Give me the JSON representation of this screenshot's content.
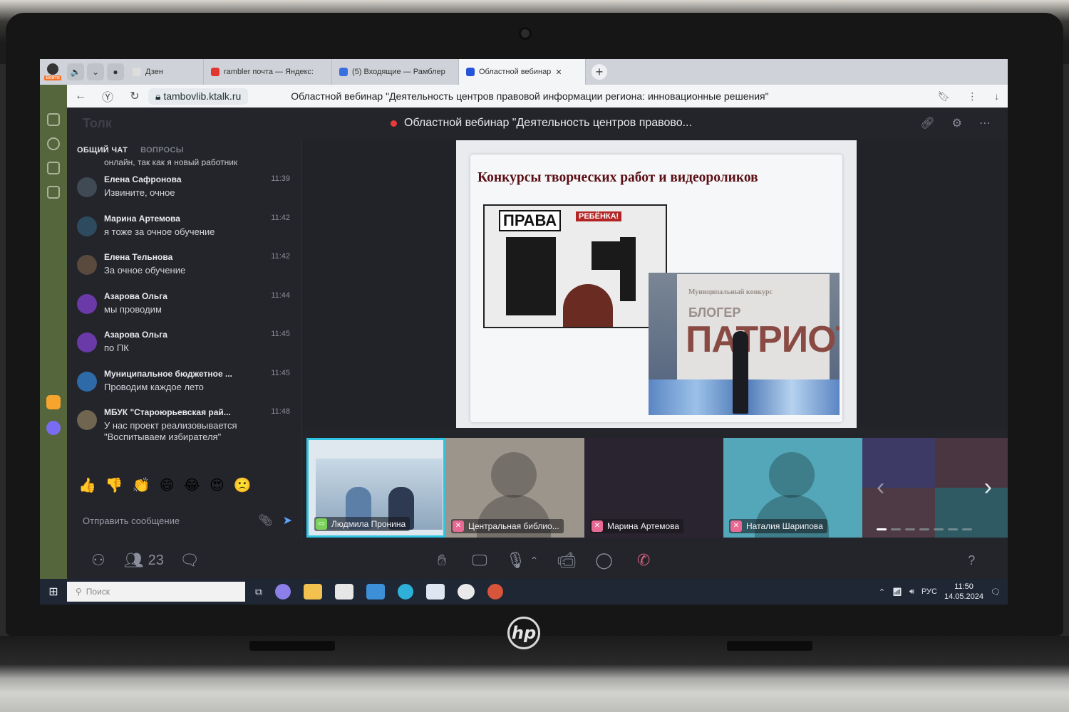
{
  "browser": {
    "profile_badge": "Войти",
    "tabs": [
      {
        "label": "Дзен",
        "icon": "zen-icon",
        "color": "#222222"
      },
      {
        "label": "rambler почта — Яндекс:",
        "icon": "yandex-icon",
        "color": "#e2372f"
      },
      {
        "label": "(5) Входящие — Рамблер",
        "icon": "mail-icon",
        "color": "#3a6fe0"
      },
      {
        "label": "Областной вебинар",
        "icon": "video-icon",
        "color": "#2455d6"
      }
    ],
    "active_tab_index": 3,
    "domain": "tambovlib.ktalk.ru",
    "page_title": "Областной вебинар \"Деятельность центров правовой информации региона: инновационные решения\""
  },
  "app": {
    "logo": "Толк",
    "meeting_title": "Областной вебинар \"Деятельность центров правово...",
    "chat": {
      "tab_general": "ОБЩИЙ ЧАТ",
      "tab_questions": "ВОПРОСЫ",
      "cut_message": "онлайн, так как я новый работник",
      "messages": [
        {
          "name": "Елена Сафронова",
          "time": "11:39",
          "text": "Извините, очное",
          "color": "#3f4a54"
        },
        {
          "name": "Марина Артемова",
          "time": "11:42",
          "text": "я тоже за очное обучение",
          "color": "#2e4a5e"
        },
        {
          "name": "Елена Тельнова",
          "time": "11:42",
          "text": "За очное обучение",
          "color": "#5a4a3e"
        },
        {
          "name": "Азарова Ольга",
          "time": "11:44",
          "text": "мы проводим",
          "color": "#6a3aa8"
        },
        {
          "name": "Азарова Ольга",
          "time": "11:45",
          "text": "по ПК",
          "color": "#6a3aa8"
        },
        {
          "name": "Муниципальное бюджетное ...",
          "time": "11:45",
          "text": "Проводим каждое лето",
          "color": "#2f6aa8"
        },
        {
          "name": "МБУК \"Староюрьевская рай...",
          "time": "11:48",
          "text": "У нас проект реализовывается \"Воспитываем избирателя\"",
          "color": "#6f6550"
        }
      ],
      "reactions": [
        "👍",
        "👎",
        "👏",
        "😄",
        "😂",
        "😍",
        "🙁"
      ],
      "compose_placeholder": "Отправить сообщение"
    },
    "slide": {
      "title": "Конкурсы творческих работ и видеороликов",
      "poster_word1": "ПРАВА",
      "poster_word2": "РЕБЁНКА!",
      "photo_line1": "Муниципальный конкурс",
      "photo_line2": "БЛОГЕР",
      "photo_line3": "ПАТРИОТ"
    },
    "participants": [
      {
        "name": "Людмила Пронина"
      },
      {
        "name": "Центральная библио..."
      },
      {
        "name": "Марина Артемова"
      },
      {
        "name": "Наталия Шарипова"
      }
    ],
    "participant_count": "23"
  },
  "taskbar": {
    "search_placeholder": "Поиск",
    "language": "РУС",
    "time": "11:50",
    "date": "14.05.2024"
  }
}
